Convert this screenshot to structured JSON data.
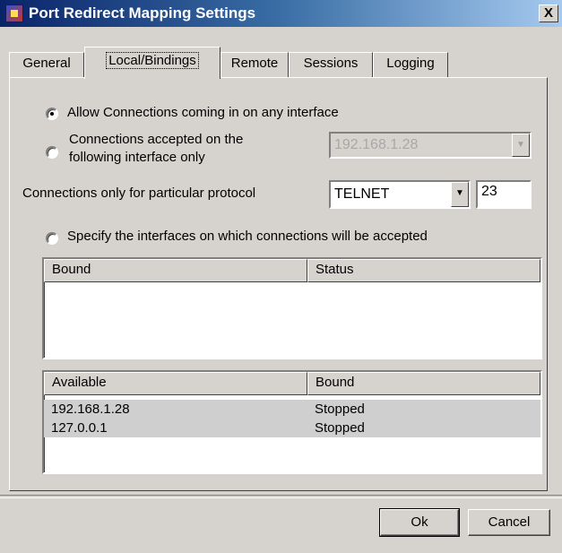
{
  "window": {
    "title": "Port Redirect Mapping Settings",
    "close_label": "X"
  },
  "tabs": [
    {
      "label": "General",
      "active": false
    },
    {
      "label": "Local/Bindings",
      "active": true
    },
    {
      "label": "Remote",
      "active": false
    },
    {
      "label": "Sessions",
      "active": false
    },
    {
      "label": "Logging",
      "active": false
    }
  ],
  "options": {
    "allow_any": {
      "label": "Allow Connections coming in on any interface",
      "checked": true
    },
    "specific_interface": {
      "label_line1": "Connections accepted on the",
      "label_line2": "following interface only",
      "checked": false,
      "interface_value": "192.168.1.28"
    },
    "protocol": {
      "label": "Connections only for particular protocol",
      "value": "TELNET",
      "port": "23"
    },
    "specify_interfaces": {
      "label": "Specify the interfaces on which connections will be accepted",
      "checked": false
    }
  },
  "bound_list": {
    "columns": [
      "Bound",
      "Status"
    ],
    "rows": []
  },
  "available_list": {
    "columns": [
      "Available",
      "Bound"
    ],
    "rows": [
      {
        "address": "192.168.1.28",
        "status": "Stopped"
      },
      {
        "address": "127.0.0.1",
        "status": "Stopped"
      }
    ]
  },
  "buttons": {
    "ok": "Ok",
    "cancel": "Cancel"
  },
  "icons": {
    "dropdown": "▼",
    "app": "app-icon"
  }
}
